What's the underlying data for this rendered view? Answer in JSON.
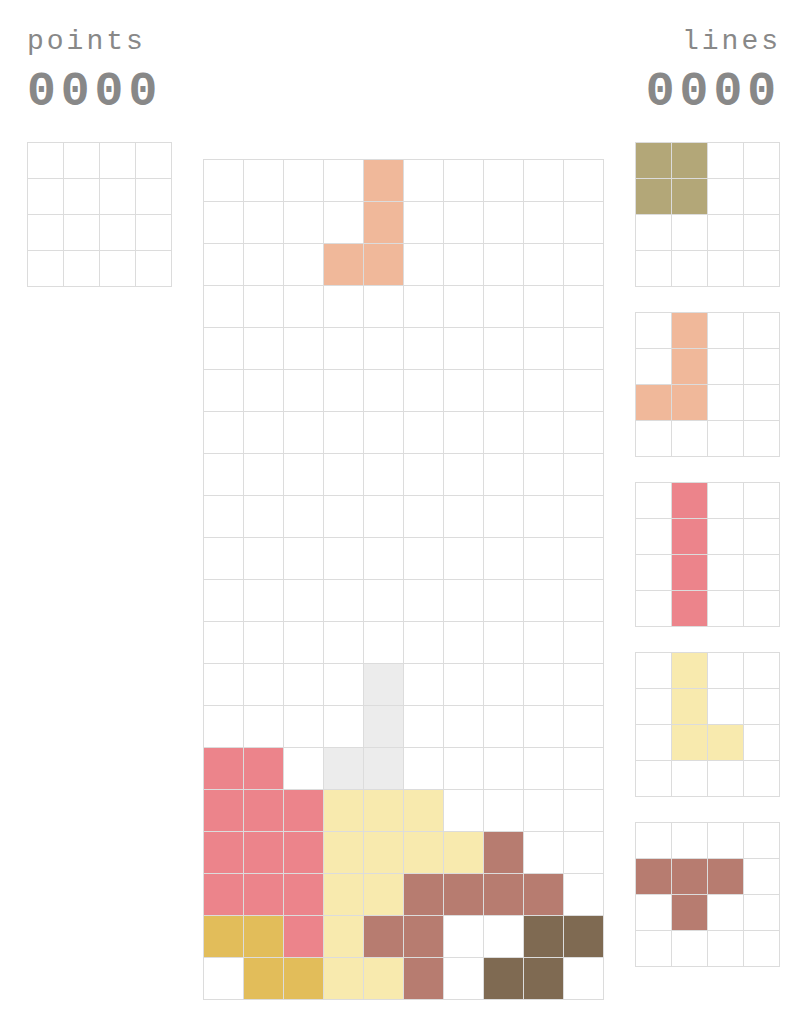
{
  "header": {
    "points_label": "points",
    "points_value": "0000",
    "lines_label": "lines",
    "lines_value": "0000"
  },
  "palette": [
    {
      "code": "P",
      "kind": "falling",
      "color": "#f0b89a"
    },
    {
      "code": "G",
      "kind": "ghost",
      "color": "#ececec"
    },
    {
      "code": "R",
      "kind": "locked",
      "color": "#ec848b"
    },
    {
      "code": "Y",
      "kind": "locked",
      "color": "#f8eaae"
    },
    {
      "code": "B",
      "kind": "locked",
      "color": "#b77c70"
    },
    {
      "code": "O",
      "kind": "locked",
      "color": "#e2bd5a"
    },
    {
      "code": "D",
      "kind": "locked",
      "color": "#7f6a52"
    },
    {
      "code": "K",
      "kind": "preview",
      "color": "#b3a778"
    }
  ],
  "board": {
    "rows": [
      "....P.....",
      "....P.....",
      "...PP.....",
      "..........",
      "..........",
      "..........",
      "..........",
      "..........",
      "..........",
      "..........",
      "..........",
      "..........",
      "....G.....",
      "....G.....",
      "RR.GG.....",
      "RRRYYY....",
      "RRRYYYYB..",
      "RRRYYBBBB.",
      "OORYBB..DD",
      ".OOYYB.DD."
    ]
  },
  "hold": {
    "rows": [
      "....",
      "....",
      "....",
      "...."
    ]
  },
  "next": [
    {
      "rows": [
        "KK..",
        "KK..",
        "....",
        "...."
      ]
    },
    {
      "rows": [
        ".P..",
        ".P..",
        "PP..",
        "...."
      ]
    },
    {
      "rows": [
        ".R..",
        ".R..",
        ".R..",
        ".R.."
      ]
    },
    {
      "rows": [
        ".Y..",
        ".Y..",
        ".YY.",
        "...."
      ]
    },
    {
      "rows": [
        "....",
        "BBB.",
        ".B..",
        "...."
      ]
    }
  ]
}
